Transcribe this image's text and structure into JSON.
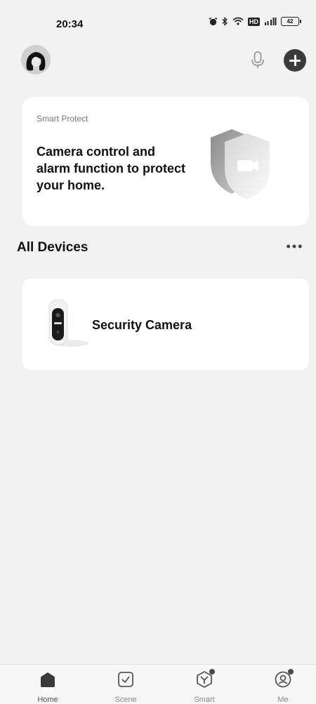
{
  "status_bar": {
    "time": "20:34",
    "battery": "42",
    "hd": "HD"
  },
  "protect_card": {
    "label": "Smart Protect",
    "text": "Camera control and alarm function to protect your home."
  },
  "devices_section": {
    "title": "All Devices",
    "more": "•••"
  },
  "devices": [
    {
      "name": "Security Camera"
    }
  ],
  "nav": {
    "items": [
      {
        "label": "Home",
        "icon": "home-icon",
        "active": true
      },
      {
        "label": "Scene",
        "icon": "scene-check-icon",
        "active": false
      },
      {
        "label": "Smart",
        "icon": "smart-icon",
        "active": false
      },
      {
        "label": "Me",
        "icon": "profile-icon",
        "active": false
      }
    ]
  }
}
